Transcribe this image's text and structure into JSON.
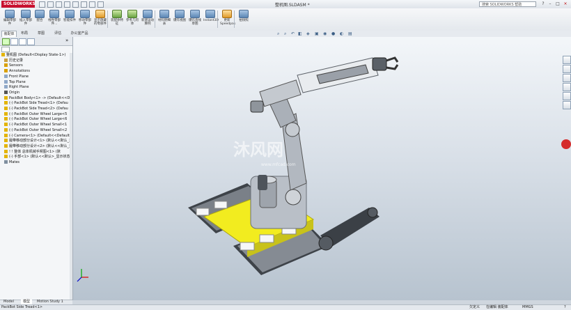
{
  "titlebar": {
    "brand": "SOLIDWORKS",
    "title": "整机图.SLDASM *",
    "search_placeholder": "搜索 SOLIDWORKS 帮助",
    "min": "–",
    "max": "□",
    "close": "×"
  },
  "ribbon": {
    "buttons": [
      {
        "label": "编辑零部件",
        "icon": "edit-component-icon",
        "style": "b"
      },
      {
        "label": "插入零部件",
        "icon": "insert-component-icon",
        "style": "b"
      },
      {
        "label": "配合",
        "icon": "mate-icon",
        "style": "b"
      },
      {
        "label": "线性零部件...",
        "icon": "linear-pattern-icon",
        "style": "b"
      },
      {
        "label": "智能扣件",
        "icon": "smart-fasteners-icon",
        "style": "b"
      },
      {
        "label": "移动零部件",
        "icon": "move-component-icon",
        "style": "b"
      },
      {
        "label": "显示隐藏的零部件",
        "icon": "show-hidden-icon",
        "style": "o"
      },
      {
        "label": "装配体特征",
        "icon": "assembly-feature-icon",
        "style": "g"
      },
      {
        "label": "参考几何体",
        "icon": "reference-geometry-icon",
        "style": "g"
      },
      {
        "label": "新建运动算例",
        "icon": "new-motion-study-icon",
        "style": "b"
      },
      {
        "label": "材料明细表",
        "icon": "bom-icon",
        "style": "b"
      },
      {
        "label": "爆炸视图",
        "icon": "exploded-view-icon",
        "style": "b"
      },
      {
        "label": "爆炸直线草图",
        "icon": "explode-line-sketch-icon",
        "style": "b"
      },
      {
        "label": "Instant3D",
        "icon": "instant3d-icon",
        "style": "b"
      },
      {
        "label": "更新Speedpak",
        "icon": "speedpak-icon",
        "style": "o"
      },
      {
        "label": "拍快照",
        "icon": "snapshot-icon",
        "style": "b"
      }
    ]
  },
  "tabs": [
    "装配体",
    "布局",
    "草图",
    "评估",
    "办公室产品"
  ],
  "feature_tree": {
    "items": [
      {
        "text": "整机图  (Default<Display State-1>)",
        "indent": 0,
        "color": "#e3b400"
      },
      {
        "text": "历史记录",
        "indent": 1,
        "color": "#c8a040"
      },
      {
        "text": "Sensors",
        "indent": 1,
        "color": "#d9a000"
      },
      {
        "text": "Annotations",
        "indent": 1,
        "color": "#d9a000"
      },
      {
        "text": "Front Plane",
        "indent": 1,
        "color": "#8fa8c8"
      },
      {
        "text": "Top Plane",
        "indent": 1,
        "color": "#8fa8c8"
      },
      {
        "text": "Right Plane",
        "indent": 1,
        "color": "#8fa8c8"
      },
      {
        "text": "Origin",
        "indent": 1,
        "color": "#555555"
      },
      {
        "text": "PackBot Body<1> -> (Default<<D",
        "indent": 1,
        "color": "#e3b400"
      },
      {
        "text": "(-) PackBot Side Tread<1> (Defau",
        "indent": 1,
        "color": "#e3b400"
      },
      {
        "text": "(-) PackBot Side Tread<2> (Defau",
        "indent": 1,
        "color": "#e3b400"
      },
      {
        "text": "(-) PackBot Outer Wheel Large<5",
        "indent": 1,
        "color": "#e3b400"
      },
      {
        "text": "(-) PackBot Outer Wheel Large<6",
        "indent": 1,
        "color": "#e3b400"
      },
      {
        "text": "(-) PackBot Outer Wheel Small<1",
        "indent": 1,
        "color": "#e3b400"
      },
      {
        "text": "(-) PackBot Outer Wheel Small<2",
        "indent": 1,
        "color": "#e3b400"
      },
      {
        "text": "(-) Camera<1> (Default<<Default",
        "indent": 1,
        "color": "#e3b400"
      },
      {
        "text": "履带移动部分设计<1> (默认<<默认_显",
        "indent": 1,
        "color": "#e3b400"
      },
      {
        "text": "履带移动部分设计<2> (默认<<默认_显",
        "indent": 1,
        "color": "#e3b400"
      },
      {
        "text": "! ! 整体 总体机械手臂图<1> (默",
        "indent": 1,
        "color": "#e3b400"
      },
      {
        "text": "(-) 手部<1> (默认<<默认>_显示状态",
        "indent": 1,
        "color": "#e3b400"
      },
      {
        "text": "Mates",
        "indent": 1,
        "color": "#7f8f9f"
      }
    ]
  },
  "bottom_tabs": [
    "Model",
    "模型",
    "Motion Study 1"
  ],
  "status": {
    "left": "PackBot Side Tread<1>",
    "middle1": "欠定义",
    "middle2": "在编辑 装配体",
    "units": "MMGS",
    "help": "?"
  },
  "watermark": {
    "main": "沐风网",
    "sub": "www.mfcad.com"
  },
  "colors": {
    "highlight": "#f2ec1f",
    "metal": "#b6bcc4",
    "dark": "#3a3f45"
  }
}
